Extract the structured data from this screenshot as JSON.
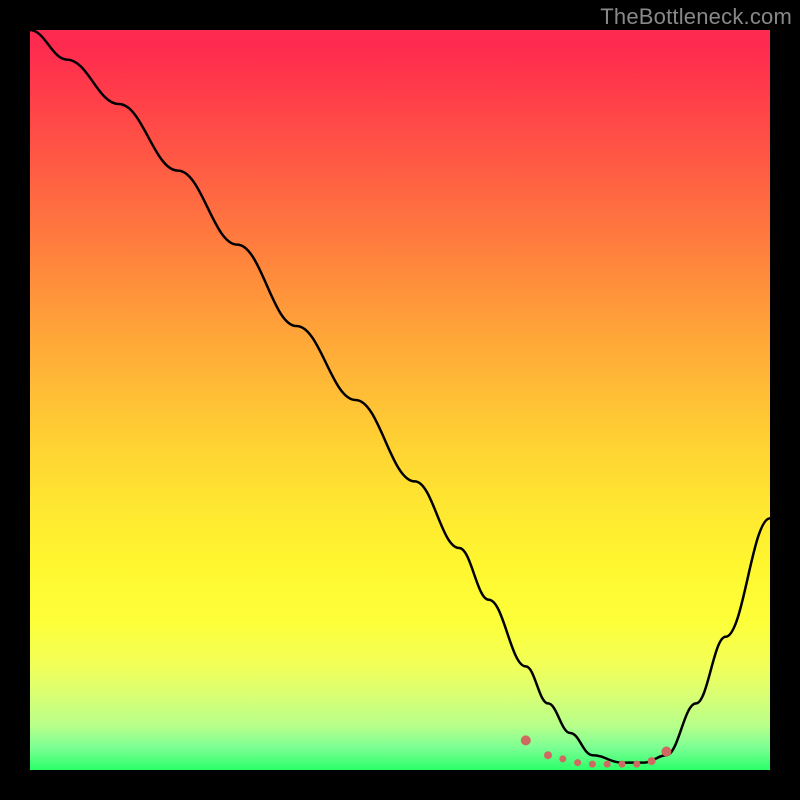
{
  "watermark": "TheBottleneck.com",
  "chart_data": {
    "type": "line",
    "title": "",
    "xlabel": "",
    "ylabel": "",
    "xlim": [
      0,
      100
    ],
    "ylim": [
      0,
      100
    ],
    "series": [
      {
        "name": "bottleneck-curve",
        "x": [
          0,
          5,
          12,
          20,
          28,
          36,
          44,
          52,
          58,
          62,
          67,
          70,
          73,
          76,
          80,
          83,
          86,
          90,
          94,
          100
        ],
        "values": [
          100,
          96,
          90,
          81,
          71,
          60,
          50,
          39,
          30,
          23,
          14,
          9,
          5,
          2,
          1,
          1,
          2,
          9,
          18,
          34
        ]
      }
    ],
    "markers": {
      "name": "highlight-dots",
      "x": [
        67,
        70,
        72,
        74,
        76,
        78,
        80,
        82,
        84,
        86
      ],
      "values": [
        4,
        2,
        1.5,
        1,
        0.8,
        0.8,
        0.8,
        0.8,
        1.2,
        2.5
      ],
      "size": [
        10,
        8,
        7,
        7,
        7,
        7,
        7,
        7,
        8,
        10
      ]
    },
    "colors": {
      "curve": "#000000",
      "marker": "#cf6a63"
    }
  }
}
